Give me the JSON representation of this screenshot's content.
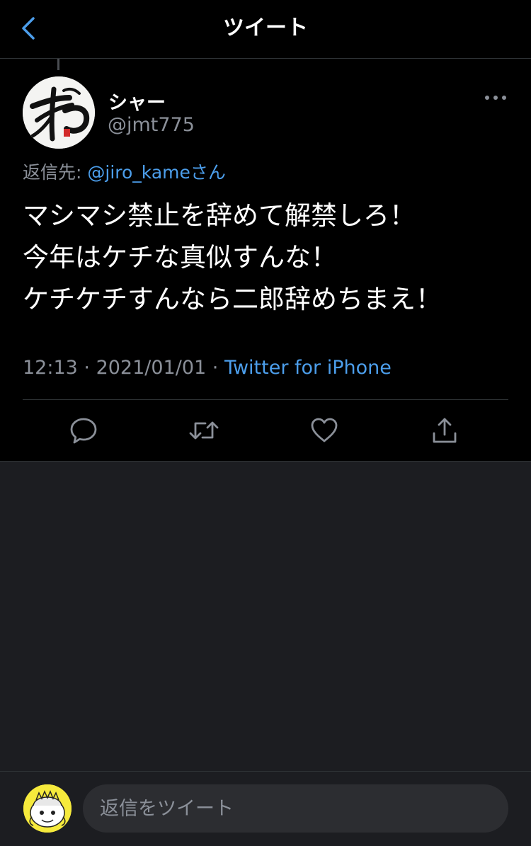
{
  "header": {
    "title": "ツイート"
  },
  "tweet": {
    "author": {
      "display_name": "シャー",
      "handle": "@jmt775"
    },
    "reply_to": {
      "prefix": "返信先: ",
      "mention": "@jiro_kame",
      "suffix": "さん"
    },
    "text_lines": [
      "マシマシ禁止を辞めて解禁しろ！",
      "今年はケチな真似すんな！",
      "ケチケチすんなら二郎辞めちまえ！"
    ],
    "time": "12:13",
    "separator": " · ",
    "date": "2021/01/01",
    "source": "Twitter for iPhone"
  },
  "actions": [
    {
      "name": "reply",
      "icon": "comment-icon"
    },
    {
      "name": "retweet",
      "icon": "retweet-icon"
    },
    {
      "name": "like",
      "icon": "heart-icon"
    },
    {
      "name": "share",
      "icon": "share-icon"
    }
  ],
  "reply_bar": {
    "placeholder": "返信をツイート"
  },
  "colors": {
    "accent": "#4c9eeb",
    "background": "#000000",
    "secondary_text": "#8b9099",
    "empty_area": "#1c1d21"
  }
}
